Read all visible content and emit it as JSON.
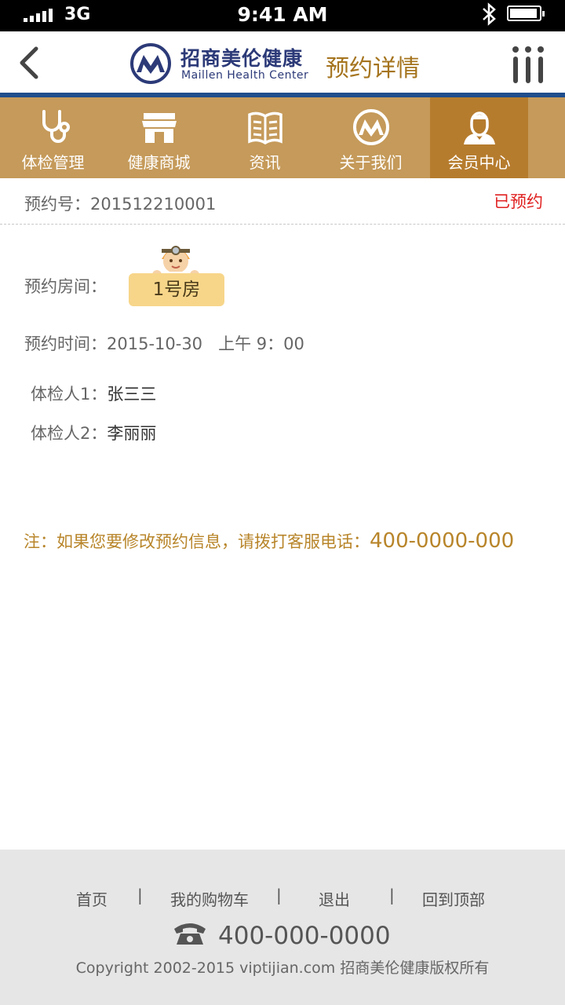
{
  "status_bar": {
    "network": "3G",
    "time": "9:41 AM"
  },
  "header": {
    "brand_cn": "招商美伦健康",
    "brand_en": "Maillen Health Center",
    "page_title": "预约详情",
    "back_icon": "chevron-left-icon",
    "menu_icon": "menu-icon"
  },
  "nav": {
    "items": [
      {
        "label": "体检管理",
        "icon": "stethoscope-icon"
      },
      {
        "label": "健康商城",
        "icon": "store-icon"
      },
      {
        "label": "资讯",
        "icon": "news-icon"
      },
      {
        "label": "关于我们",
        "icon": "logo-icon"
      },
      {
        "label": "会员中心",
        "icon": "member-icon"
      }
    ],
    "active_index": 4
  },
  "appointment": {
    "order_label": "预约号：",
    "order_number": "201512210001",
    "status": "已预约",
    "room_label": "预约房间：",
    "room_value": "1号房",
    "time_label": "预约时间：",
    "date": "2015-10-30",
    "time": "上午 9：00",
    "persons": [
      {
        "label": "体检人1：",
        "name": "张三三"
      },
      {
        "label": "体检人2：",
        "name": "李丽丽"
      }
    ]
  },
  "note": {
    "text": "注：如果您要修改预约信息，请拨打客服电话：",
    "phone": "400-0000-000"
  },
  "footer": {
    "links": [
      "首页",
      "我的购物车",
      "退出",
      "回到顶部"
    ],
    "separator": "|",
    "phone": "400-000-0000",
    "copyright": "Copyright 2002-2015 viptijian.com  招商美伦健康版权所有"
  },
  "colors": {
    "nav_bg": "#c59a5a",
    "nav_active": "#b67c2e",
    "header_rule": "#1f4d8c",
    "accent": "#a5741e",
    "status_red": "#e02020",
    "badge": "#f7d68a"
  }
}
